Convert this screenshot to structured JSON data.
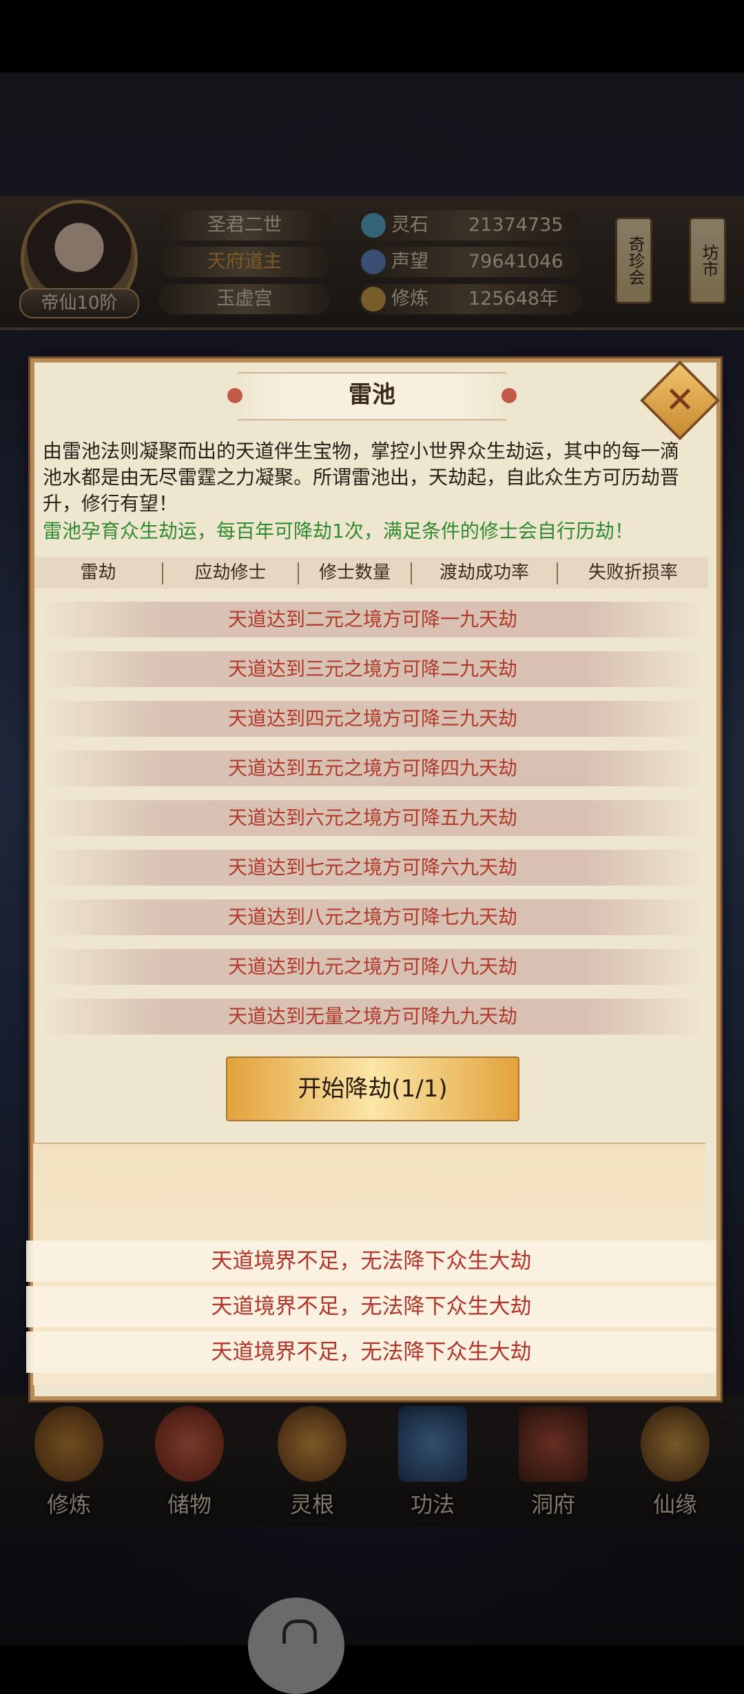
{
  "header": {
    "rank": "帝仙10阶",
    "titles": [
      "圣君二世",
      "天府道主",
      "玉虚宫"
    ],
    "stats": [
      {
        "label": "灵石",
        "value": "21374735",
        "icon": "spirit-stone-icon",
        "color": "#5fb6d6"
      },
      {
        "label": "声望",
        "value": "79641046",
        "icon": "prestige-icon",
        "color": "#6a8fd1"
      },
      {
        "label": "修炼",
        "value": "125648年",
        "icon": "cultivation-icon",
        "color": "#d9a94b"
      }
    ],
    "side_buttons": [
      "奇珍会",
      "坊市"
    ]
  },
  "modal": {
    "title": "雷池",
    "description": "由雷池法则凝聚而出的天道伴生宝物，掌控小世界众生劫运，其中的每一滴池水都是由无尽雷霆之力凝聚。所谓雷池出，天劫起，自此众生方可历劫晋升，修行有望！",
    "hint": "雷池孕育众生劫运，每百年可降劫1次，满足条件的修士会自行历劫！",
    "columns": [
      "雷劫",
      "应劫修士",
      "修士数量",
      "渡劫成功率",
      "失败折损率"
    ],
    "rows": [
      "天道达到二元之境方可降一九天劫",
      "天道达到三元之境方可降二九天劫",
      "天道达到四元之境方可降三九天劫",
      "天道达到五元之境方可降四九天劫",
      "天道达到六元之境方可降五九天劫",
      "天道达到七元之境方可降六九天劫",
      "天道达到八元之境方可降七九天劫",
      "天道达到九元之境方可降八九天劫",
      "天道达到无量之境方可降九九天劫"
    ],
    "start_button": "开始降劫(1/1)",
    "log": [
      "天道境界不足，无法降下众生大劫",
      "天道境界不足，无法降下众生大劫",
      "天道境界不足，无法降下众生大劫"
    ]
  },
  "nav": [
    {
      "label": "修炼",
      "icon": "cultivate-icon"
    },
    {
      "label": "储物",
      "icon": "storage-bag-icon"
    },
    {
      "label": "灵根",
      "icon": "spirit-root-icon"
    },
    {
      "label": "功法",
      "icon": "technique-book-icon"
    },
    {
      "label": "洞府",
      "icon": "cave-dwelling-icon"
    },
    {
      "label": "仙缘",
      "icon": "immortal-fate-icon"
    }
  ]
}
